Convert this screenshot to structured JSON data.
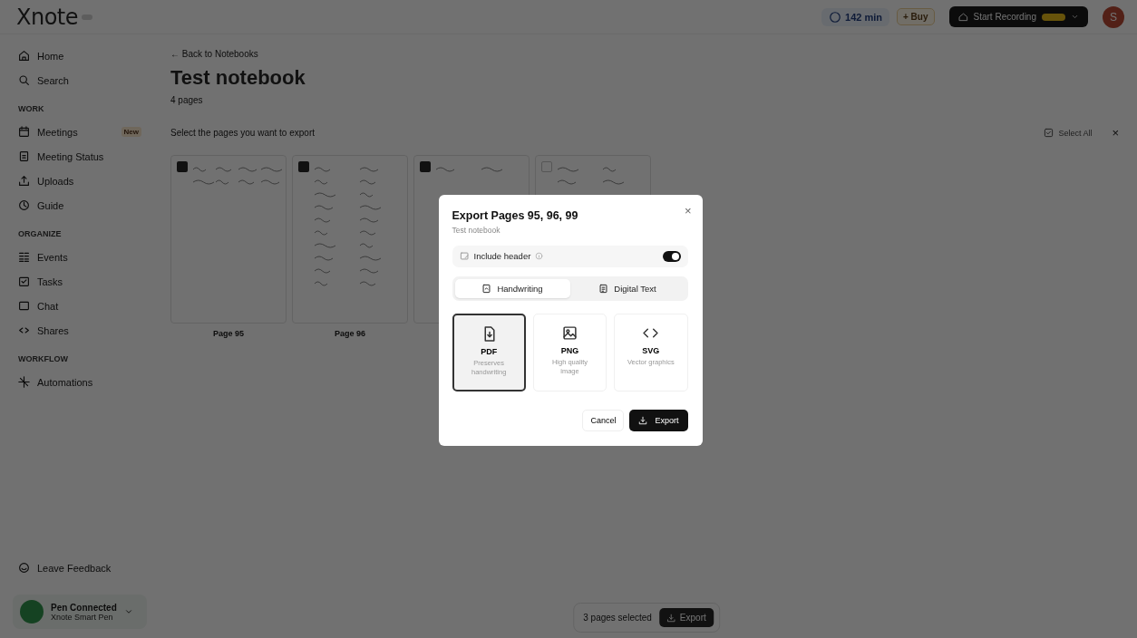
{
  "topbar": {
    "logo": "Xnote",
    "usage": "142 min",
    "buy": "+ Buy",
    "record": "Start Recording",
    "avatar": "S"
  },
  "sidebar": {
    "items": [
      {
        "kind": "item",
        "label": "Home"
      },
      {
        "kind": "item",
        "label": "Search"
      },
      {
        "kind": "section",
        "label": "WORK"
      },
      {
        "kind": "item",
        "label": "Meetings",
        "badge": "New"
      },
      {
        "kind": "item",
        "label": "Meeting Status"
      },
      {
        "kind": "item",
        "label": "Uploads"
      },
      {
        "kind": "item",
        "label": "Guide"
      },
      {
        "kind": "section",
        "label": "ORGANIZE"
      },
      {
        "kind": "item",
        "label": "Events"
      },
      {
        "kind": "item",
        "label": "Tasks"
      },
      {
        "kind": "item",
        "label": "Chat"
      },
      {
        "kind": "item",
        "label": "Shares"
      },
      {
        "kind": "section",
        "label": "WORKFLOW"
      },
      {
        "kind": "item",
        "label": "Automations"
      }
    ],
    "feedback": "Leave Feedback",
    "pen": {
      "title": "Pen Connected",
      "subtitle": "Xnote Smart Pen"
    }
  },
  "notebook": {
    "back": "← Back to Notebooks",
    "title": "Test notebook",
    "subtitle": "4 pages",
    "instruction": "Select the pages you want to export",
    "select_all": "Select All",
    "close": "×",
    "pages": [
      {
        "label": "Page 95",
        "checked": true
      },
      {
        "label": "Page 96",
        "checked": true
      },
      {
        "checked": true
      },
      {
        "checked": false
      }
    ],
    "selection": {
      "text": "3 pages selected",
      "button": "Export"
    }
  },
  "dialog": {
    "title": "Export Pages 95, 96, 99",
    "subtitle": "Test notebook",
    "close": "×",
    "include_header": {
      "label": "Include header",
      "on": true
    },
    "modes": [
      {
        "kind": "handwriting",
        "label": "Handwriting",
        "selected": true
      },
      {
        "kind": "digital",
        "label": "Digital Text",
        "selected": false
      }
    ],
    "formats": [
      {
        "kind": "pdf",
        "name": "PDF",
        "description": "Preserves handwriting",
        "selected": true
      },
      {
        "kind": "png",
        "name": "PNG",
        "description": "High quality image",
        "selected": false
      },
      {
        "kind": "svg",
        "name": "SVG",
        "description": "Vector graphics",
        "selected": false
      }
    ],
    "cancel": "Cancel",
    "export": "Export"
  }
}
